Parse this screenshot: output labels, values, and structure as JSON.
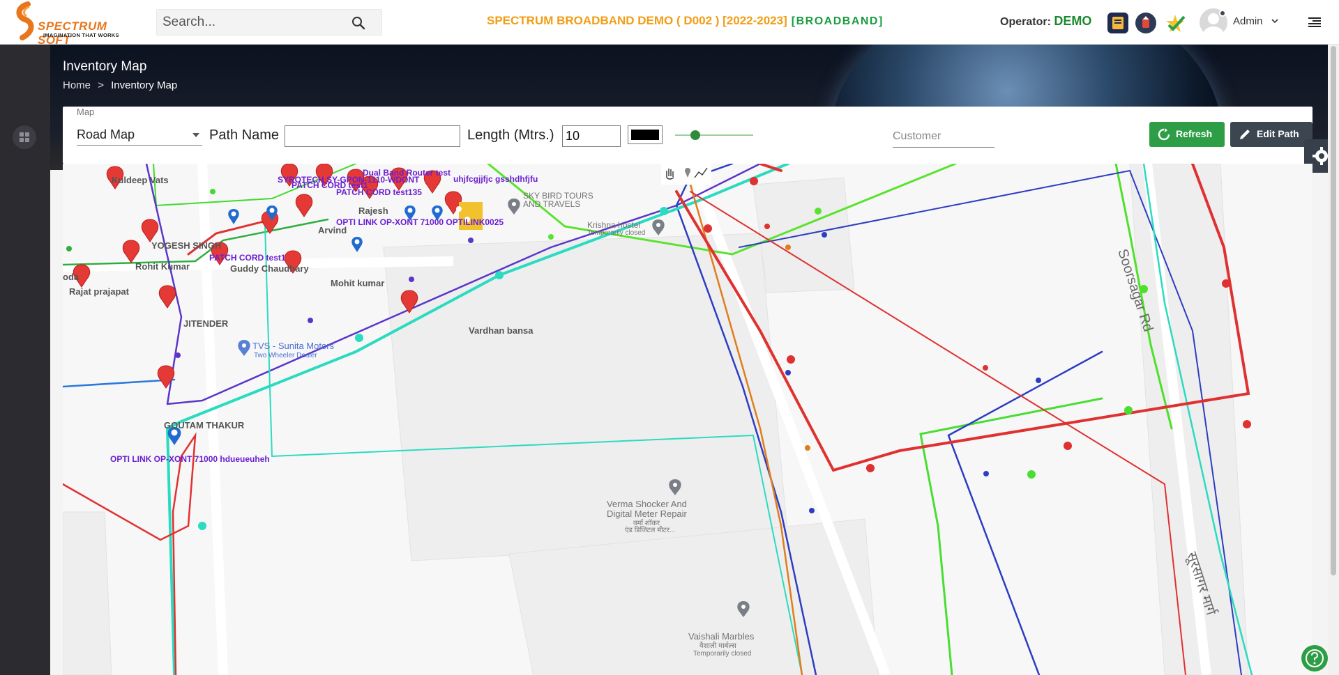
{
  "header": {
    "logo_text": "SPECTRUM SOFT",
    "logo_tagline": "IMAGINATION THAT WORKS",
    "search_placeholder": "Search...",
    "company_title": "SPECTRUM BROADBAND DEMO ( D002 ) [2022-2023]",
    "company_tag": "[BROADBAND]",
    "operator_label": "Operator:",
    "operator_value": "DEMO",
    "user_name": "Admin"
  },
  "page": {
    "title": "Inventory Map",
    "breadcrumb_home": "Home",
    "breadcrumb_current": "Inventory Map"
  },
  "toolbar": {
    "map_label": "Map",
    "map_type": "Road Map",
    "path_name_label": "Path Name",
    "path_name_value": "",
    "length_label": "Length (Mtrs.)",
    "length_value": "10",
    "path_color": "#000000",
    "slider_level": 0.2,
    "customer_placeholder": "Customer",
    "refresh_label": "Refresh",
    "edit_path_label": "Edit Path"
  },
  "map": {
    "markers": [
      {
        "label": "Kuldeep Vats"
      },
      {
        "label": "YOGESH SINGH"
      },
      {
        "label": "Rohit Kumar"
      },
      {
        "label": "Rajat prajapat"
      },
      {
        "label": "JITENDER"
      },
      {
        "label": "GOUTAM THAKUR"
      },
      {
        "label": "Guddy Chaudhary"
      },
      {
        "label": "Arvind"
      },
      {
        "label": "Mohit kumar"
      },
      {
        "label": "Vardhan bansa"
      },
      {
        "label": "Rajesh"
      }
    ],
    "devices": [
      {
        "label": "Dual Band Router test"
      },
      {
        "label": "SYROTECH SY-GPON-1110-WDONT"
      },
      {
        "label": "PATCH CORD test1"
      },
      {
        "label": "PATCH CORD test135"
      },
      {
        "label": "OPTI LINK OP-XONT 71000 OPTILINK0025"
      },
      {
        "label": "PATCH CORD test1"
      },
      {
        "label": "OPTI LINK OP-XONT 71000 hdueueuheh"
      },
      {
        "label": "uhjfcgjjfjc gsshdhfjfu"
      }
    ],
    "places": [
      {
        "name": "SKY BIRD TOURS",
        "sub": "AND TRAVELS"
      },
      {
        "name": "Krishna hostel",
        "sub": "Temporarily closed"
      },
      {
        "name": "TVS - Sunita Motors",
        "sub": "Two Wheeler Dealer"
      },
      {
        "name": "Verma Shocker And",
        "sub": "Digital Meter Repair"
      },
      {
        "name": "Vaishali Marbles",
        "sub": "Temporarily closed"
      }
    ],
    "place_hindi": {
      "verma": "वर्मा शॉकर",
      "verma2": "एंड डिजिटल मीटर...",
      "vaishali": "वैशाली मार्बल्स"
    },
    "roads": [
      {
        "name": "Soorsagar Rd"
      },
      {
        "name": "सूरसागर मार्ग"
      }
    ],
    "edge_labels": [
      "oda",
      "Temporarily closed"
    ]
  }
}
